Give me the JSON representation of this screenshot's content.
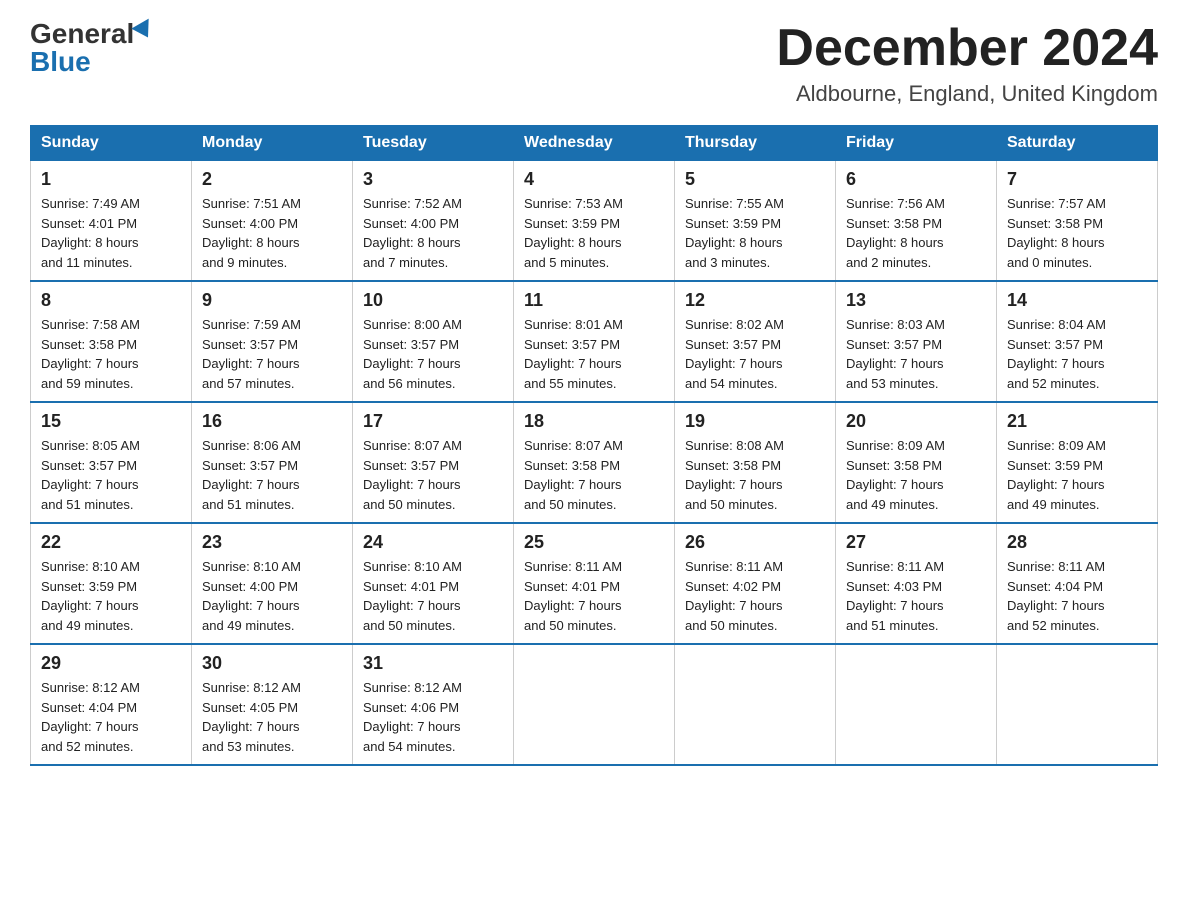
{
  "logo": {
    "general": "General",
    "blue": "Blue"
  },
  "title": {
    "month": "December 2024",
    "location": "Aldbourne, England, United Kingdom"
  },
  "headers": [
    "Sunday",
    "Monday",
    "Tuesday",
    "Wednesday",
    "Thursday",
    "Friday",
    "Saturday"
  ],
  "weeks": [
    [
      {
        "day": "1",
        "info": "Sunrise: 7:49 AM\nSunset: 4:01 PM\nDaylight: 8 hours\nand 11 minutes."
      },
      {
        "day": "2",
        "info": "Sunrise: 7:51 AM\nSunset: 4:00 PM\nDaylight: 8 hours\nand 9 minutes."
      },
      {
        "day": "3",
        "info": "Sunrise: 7:52 AM\nSunset: 4:00 PM\nDaylight: 8 hours\nand 7 minutes."
      },
      {
        "day": "4",
        "info": "Sunrise: 7:53 AM\nSunset: 3:59 PM\nDaylight: 8 hours\nand 5 minutes."
      },
      {
        "day": "5",
        "info": "Sunrise: 7:55 AM\nSunset: 3:59 PM\nDaylight: 8 hours\nand 3 minutes."
      },
      {
        "day": "6",
        "info": "Sunrise: 7:56 AM\nSunset: 3:58 PM\nDaylight: 8 hours\nand 2 minutes."
      },
      {
        "day": "7",
        "info": "Sunrise: 7:57 AM\nSunset: 3:58 PM\nDaylight: 8 hours\nand 0 minutes."
      }
    ],
    [
      {
        "day": "8",
        "info": "Sunrise: 7:58 AM\nSunset: 3:58 PM\nDaylight: 7 hours\nand 59 minutes."
      },
      {
        "day": "9",
        "info": "Sunrise: 7:59 AM\nSunset: 3:57 PM\nDaylight: 7 hours\nand 57 minutes."
      },
      {
        "day": "10",
        "info": "Sunrise: 8:00 AM\nSunset: 3:57 PM\nDaylight: 7 hours\nand 56 minutes."
      },
      {
        "day": "11",
        "info": "Sunrise: 8:01 AM\nSunset: 3:57 PM\nDaylight: 7 hours\nand 55 minutes."
      },
      {
        "day": "12",
        "info": "Sunrise: 8:02 AM\nSunset: 3:57 PM\nDaylight: 7 hours\nand 54 minutes."
      },
      {
        "day": "13",
        "info": "Sunrise: 8:03 AM\nSunset: 3:57 PM\nDaylight: 7 hours\nand 53 minutes."
      },
      {
        "day": "14",
        "info": "Sunrise: 8:04 AM\nSunset: 3:57 PM\nDaylight: 7 hours\nand 52 minutes."
      }
    ],
    [
      {
        "day": "15",
        "info": "Sunrise: 8:05 AM\nSunset: 3:57 PM\nDaylight: 7 hours\nand 51 minutes."
      },
      {
        "day": "16",
        "info": "Sunrise: 8:06 AM\nSunset: 3:57 PM\nDaylight: 7 hours\nand 51 minutes."
      },
      {
        "day": "17",
        "info": "Sunrise: 8:07 AM\nSunset: 3:57 PM\nDaylight: 7 hours\nand 50 minutes."
      },
      {
        "day": "18",
        "info": "Sunrise: 8:07 AM\nSunset: 3:58 PM\nDaylight: 7 hours\nand 50 minutes."
      },
      {
        "day": "19",
        "info": "Sunrise: 8:08 AM\nSunset: 3:58 PM\nDaylight: 7 hours\nand 50 minutes."
      },
      {
        "day": "20",
        "info": "Sunrise: 8:09 AM\nSunset: 3:58 PM\nDaylight: 7 hours\nand 49 minutes."
      },
      {
        "day": "21",
        "info": "Sunrise: 8:09 AM\nSunset: 3:59 PM\nDaylight: 7 hours\nand 49 minutes."
      }
    ],
    [
      {
        "day": "22",
        "info": "Sunrise: 8:10 AM\nSunset: 3:59 PM\nDaylight: 7 hours\nand 49 minutes."
      },
      {
        "day": "23",
        "info": "Sunrise: 8:10 AM\nSunset: 4:00 PM\nDaylight: 7 hours\nand 49 minutes."
      },
      {
        "day": "24",
        "info": "Sunrise: 8:10 AM\nSunset: 4:01 PM\nDaylight: 7 hours\nand 50 minutes."
      },
      {
        "day": "25",
        "info": "Sunrise: 8:11 AM\nSunset: 4:01 PM\nDaylight: 7 hours\nand 50 minutes."
      },
      {
        "day": "26",
        "info": "Sunrise: 8:11 AM\nSunset: 4:02 PM\nDaylight: 7 hours\nand 50 minutes."
      },
      {
        "day": "27",
        "info": "Sunrise: 8:11 AM\nSunset: 4:03 PM\nDaylight: 7 hours\nand 51 minutes."
      },
      {
        "day": "28",
        "info": "Sunrise: 8:11 AM\nSunset: 4:04 PM\nDaylight: 7 hours\nand 52 minutes."
      }
    ],
    [
      {
        "day": "29",
        "info": "Sunrise: 8:12 AM\nSunset: 4:04 PM\nDaylight: 7 hours\nand 52 minutes."
      },
      {
        "day": "30",
        "info": "Sunrise: 8:12 AM\nSunset: 4:05 PM\nDaylight: 7 hours\nand 53 minutes."
      },
      {
        "day": "31",
        "info": "Sunrise: 8:12 AM\nSunset: 4:06 PM\nDaylight: 7 hours\nand 54 minutes."
      },
      {
        "day": "",
        "info": ""
      },
      {
        "day": "",
        "info": ""
      },
      {
        "day": "",
        "info": ""
      },
      {
        "day": "",
        "info": ""
      }
    ]
  ]
}
